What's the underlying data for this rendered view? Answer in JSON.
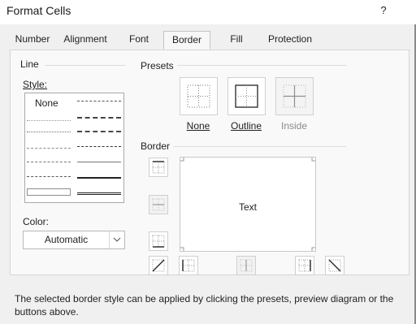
{
  "window": {
    "title": "Format Cells",
    "help": "?"
  },
  "tabs": [
    {
      "label": "Number",
      "active": false
    },
    {
      "label": "Alignment",
      "active": false
    },
    {
      "label": "Font",
      "active": false
    },
    {
      "label": "Border",
      "active": true
    },
    {
      "label": "Fill",
      "active": false
    },
    {
      "label": "Protection",
      "active": false
    }
  ],
  "line": {
    "group_label": "Line",
    "style_label": "Style:",
    "none_label": "None",
    "color_label": "Color:",
    "color_value": "Automatic"
  },
  "presets": {
    "group_label": "Presets",
    "items": [
      {
        "label": "None",
        "enabled": true
      },
      {
        "label": "Outline",
        "enabled": true
      },
      {
        "label": "Inside",
        "enabled": false
      }
    ]
  },
  "border": {
    "group_label": "Border",
    "preview_text": "Text"
  },
  "footer_text": "The selected border style can be applied by clicking the presets, preview diagram or the buttons above."
}
